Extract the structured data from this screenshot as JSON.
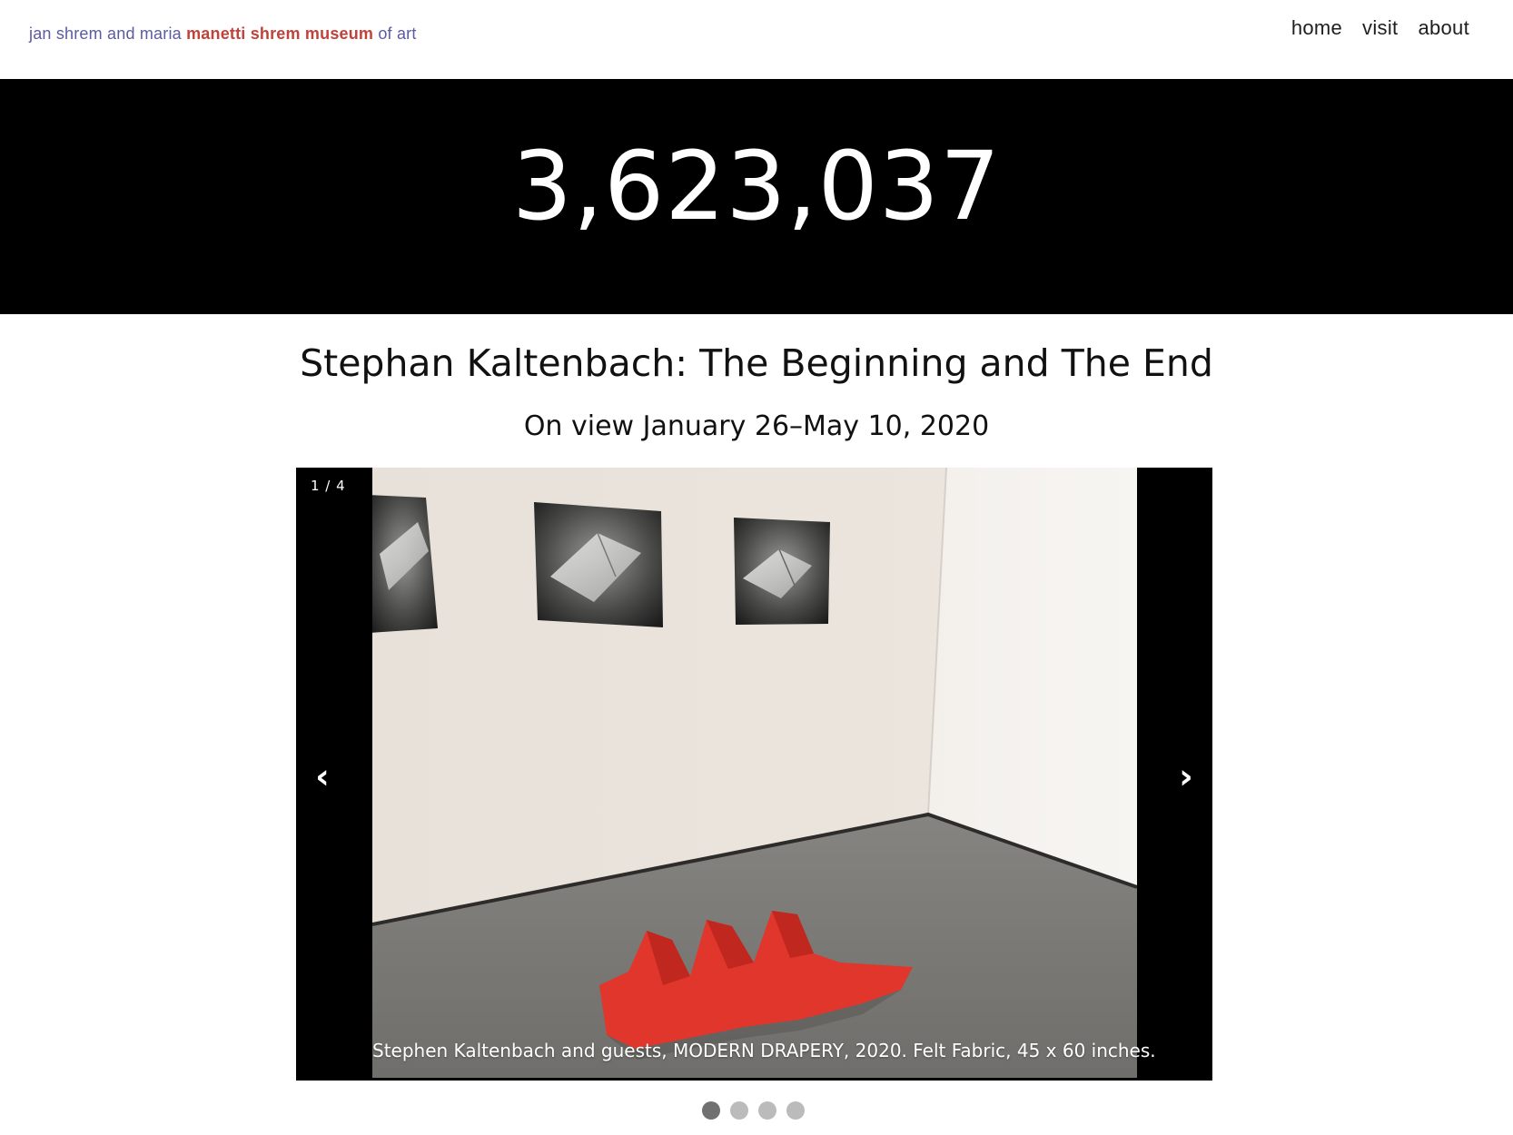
{
  "header": {
    "logo": {
      "prefix": "jan shrem and maria ",
      "emphasis": "manetti shrem museum",
      "suffix": " of art"
    },
    "nav": [
      {
        "label": "home"
      },
      {
        "label": "visit"
      },
      {
        "label": "about"
      }
    ]
  },
  "counter": {
    "value": "3,623,037"
  },
  "exhibition": {
    "title": "Stephan Kaltenbach: The Beginning and The End",
    "dates": "On view January 26–May 10, 2020"
  },
  "slideshow": {
    "counter": "1 / 4",
    "prev_label": "‹",
    "next_label": "›",
    "caption": "Stephen Kaltenbach and guests, MODERN DRAPERY, 2020. Felt Fabric, 45 x 60 inches.",
    "total_slides": 4,
    "current_slide": 1
  },
  "colors": {
    "brand_blue": "#5b5aa3",
    "brand_red": "#c2423a",
    "artwork_red": "#e0362c"
  }
}
